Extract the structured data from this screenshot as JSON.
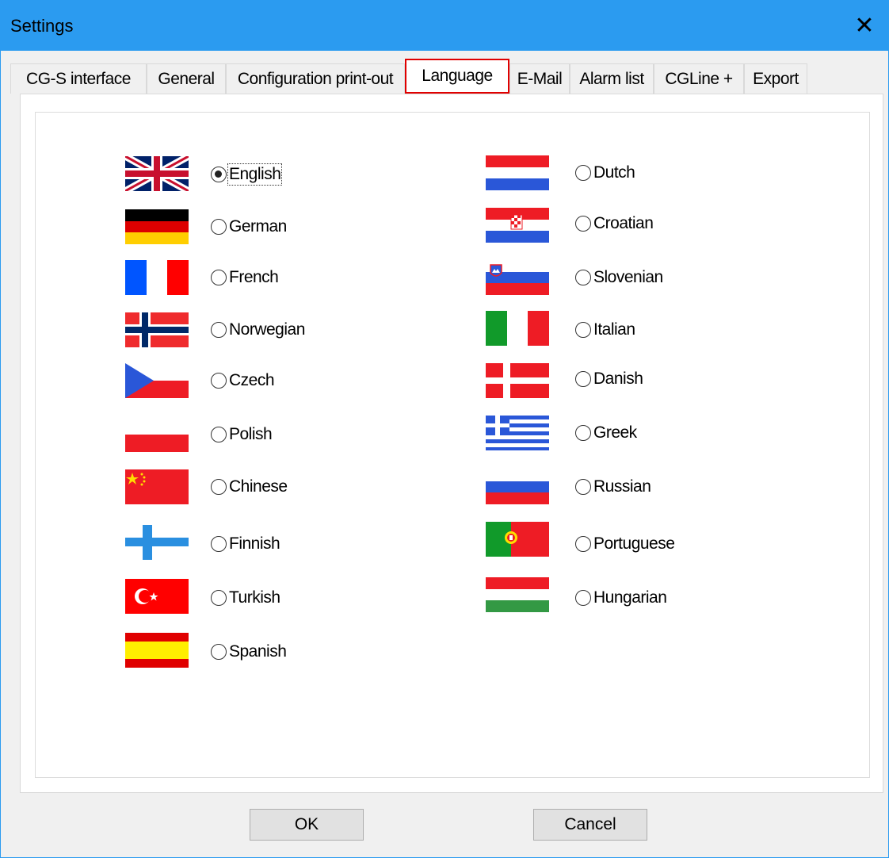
{
  "window": {
    "title": "Settings"
  },
  "tabs": [
    {
      "label": "CG-S interface"
    },
    {
      "label": "General"
    },
    {
      "label": "Configuration print-out"
    },
    {
      "label": "Language"
    },
    {
      "label": "E-Mail"
    },
    {
      "label": "Alarm list"
    },
    {
      "label": "CGLine +"
    },
    {
      "label": "Export"
    }
  ],
  "active_tab": "Language",
  "languages": [
    {
      "label": "English",
      "selected": true
    },
    {
      "label": "German",
      "selected": false
    },
    {
      "label": "French",
      "selected": false
    },
    {
      "label": "Norwegian",
      "selected": false
    },
    {
      "label": "Czech",
      "selected": false
    },
    {
      "label": "Polish",
      "selected": false
    },
    {
      "label": "Chinese",
      "selected": false
    },
    {
      "label": "Finnish",
      "selected": false
    },
    {
      "label": "Turkish",
      "selected": false
    },
    {
      "label": "Spanish",
      "selected": false
    },
    {
      "label": "Dutch",
      "selected": false
    },
    {
      "label": "Croatian",
      "selected": false
    },
    {
      "label": "Slovenian",
      "selected": false
    },
    {
      "label": "Italian",
      "selected": false
    },
    {
      "label": "Danish",
      "selected": false
    },
    {
      "label": "Greek",
      "selected": false
    },
    {
      "label": "Russian",
      "selected": false
    },
    {
      "label": "Portuguese",
      "selected": false
    },
    {
      "label": "Hungarian",
      "selected": false
    }
  ],
  "buttons": {
    "ok": "OK",
    "cancel": "Cancel"
  },
  "icons": {
    "close": "close-icon"
  },
  "colors": {
    "titlebar": "#2b9bf0",
    "highlight": "#e00000"
  }
}
